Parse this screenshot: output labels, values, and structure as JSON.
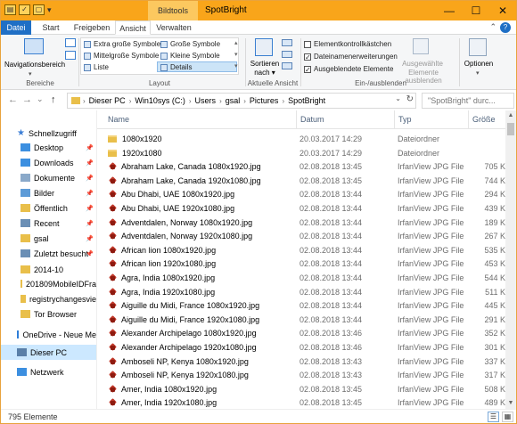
{
  "titlebar": {
    "title": "SpotBright",
    "context_tab": "Bildtools",
    "minimize": "—",
    "maximize": "☐",
    "close": "✕"
  },
  "tabs": [
    {
      "label": "Datei"
    },
    {
      "label": "Start"
    },
    {
      "label": "Freigeben"
    },
    {
      "label": "Ansicht"
    },
    {
      "label": "Verwalten"
    }
  ],
  "ribbon": {
    "bereiche": {
      "nav_pane": "Navigationsbereich",
      "label": "Bereiche"
    },
    "layout": {
      "items": [
        "Extra große Symbole",
        "Große Symbole",
        "Mittelgroße Symbole",
        "Kleine Symbole",
        "Liste",
        "Details"
      ],
      "label": "Layout"
    },
    "aktuelle_ansicht": {
      "sort": "Sortieren",
      "sort_sub": "nach ▾",
      "label": "Aktuelle Ansicht"
    },
    "ein_ausblenden": {
      "checkboxes": [
        {
          "label": "Elementkontrollkästchen",
          "checked": false
        },
        {
          "label": "Dateinamenerweiterungen",
          "checked": true
        },
        {
          "label": "Ausgeblendete Elemente",
          "checked": true
        }
      ],
      "hide_selected": "Ausgewählte",
      "hide_selected2": "Elemente ausblenden",
      "label": "Ein-/ausblenden"
    },
    "options": {
      "label": "Optionen"
    }
  },
  "address": {
    "crumbs": [
      "Dieser PC",
      "Win10sys (C:)",
      "Users",
      "gsal",
      "Pictures",
      "SpotBright"
    ],
    "search_placeholder": "\"SpotBright\" durc...",
    "back": "←",
    "forward": "→",
    "recent": "⌄",
    "up": "↑"
  },
  "navpane": {
    "items": [
      {
        "label": "Schnellzugriff",
        "kind": "star",
        "pinned": false,
        "selected": false,
        "indent": 0
      },
      {
        "label": "Desktop",
        "kind": "folder-blue",
        "pinned": true,
        "selected": false,
        "indent": 1
      },
      {
        "label": "Downloads",
        "kind": "download",
        "pinned": true,
        "selected": false,
        "indent": 1
      },
      {
        "label": "Dokumente",
        "kind": "doc",
        "pinned": true,
        "selected": false,
        "indent": 1
      },
      {
        "label": "Bilder",
        "kind": "pic",
        "pinned": true,
        "selected": false,
        "indent": 1
      },
      {
        "label": "Öffentlich",
        "kind": "folder",
        "pinned": true,
        "selected": false,
        "indent": 1
      },
      {
        "label": "Recent",
        "kind": "recent",
        "pinned": true,
        "selected": false,
        "indent": 1
      },
      {
        "label": "gsal",
        "kind": "folder",
        "pinned": true,
        "selected": false,
        "indent": 1
      },
      {
        "label": "Zuletzt besucht",
        "kind": "recent",
        "pinned": true,
        "selected": false,
        "indent": 1
      },
      {
        "label": "2014-10",
        "kind": "folder",
        "pinned": false,
        "selected": false,
        "indent": 1
      },
      {
        "label": "201809MobileIDFra",
        "kind": "folder",
        "pinned": false,
        "selected": false,
        "indent": 1
      },
      {
        "label": "registrychangesvie",
        "kind": "folder",
        "pinned": false,
        "selected": false,
        "indent": 1
      },
      {
        "label": "Tor Browser",
        "kind": "folder",
        "pinned": false,
        "selected": false,
        "indent": 1
      },
      {
        "label": "OneDrive - Neue Me",
        "kind": "cloud",
        "pinned": false,
        "selected": false,
        "indent": 0
      },
      {
        "label": "Dieser PC",
        "kind": "pc",
        "pinned": false,
        "selected": true,
        "indent": 0
      },
      {
        "label": "Netzwerk",
        "kind": "net",
        "pinned": false,
        "selected": false,
        "indent": 0
      }
    ]
  },
  "filelist": {
    "headers": [
      "Name",
      "Datum",
      "Typ",
      "Größe"
    ],
    "rows": [
      {
        "name": "1080x1920",
        "date": "20.03.2017 14:29",
        "type": "Dateiordner",
        "size": "",
        "kind": "folder"
      },
      {
        "name": "1920x1080",
        "date": "20.03.2017 14:29",
        "type": "Dateiordner",
        "size": "",
        "kind": "folder"
      },
      {
        "name": "Abraham Lake, Canada 1080x1920.jpg",
        "date": "02.08.2018 13:45",
        "type": "IrfanView JPG File",
        "size": "705 K",
        "kind": "jpg"
      },
      {
        "name": "Abraham Lake, Canada 1920x1080.jpg",
        "date": "02.08.2018 13:45",
        "type": "IrfanView JPG File",
        "size": "744 K",
        "kind": "jpg"
      },
      {
        "name": "Abu Dhabi, UAE 1080x1920.jpg",
        "date": "02.08.2018 13:44",
        "type": "IrfanView JPG File",
        "size": "294 K",
        "kind": "jpg"
      },
      {
        "name": "Abu Dhabi, UAE 1920x1080.jpg",
        "date": "02.08.2018 13:44",
        "type": "IrfanView JPG File",
        "size": "439 K",
        "kind": "jpg"
      },
      {
        "name": "Adventdalen, Norway 1080x1920.jpg",
        "date": "02.08.2018 13:44",
        "type": "IrfanView JPG File",
        "size": "189 K",
        "kind": "jpg"
      },
      {
        "name": "Adventdalen, Norway 1920x1080.jpg",
        "date": "02.08.2018 13:44",
        "type": "IrfanView JPG File",
        "size": "267 K",
        "kind": "jpg"
      },
      {
        "name": "African lion 1080x1920.jpg",
        "date": "02.08.2018 13:44",
        "type": "IrfanView JPG File",
        "size": "535 K",
        "kind": "jpg"
      },
      {
        "name": "African lion 1920x1080.jpg",
        "date": "02.08.2018 13:44",
        "type": "IrfanView JPG File",
        "size": "453 K",
        "kind": "jpg"
      },
      {
        "name": "Agra, India 1080x1920.jpg",
        "date": "02.08.2018 13:44",
        "type": "IrfanView JPG File",
        "size": "544 K",
        "kind": "jpg"
      },
      {
        "name": "Agra, India 1920x1080.jpg",
        "date": "02.08.2018 13:44",
        "type": "IrfanView JPG File",
        "size": "511 K",
        "kind": "jpg"
      },
      {
        "name": "Aiguille du Midi, France 1080x1920.jpg",
        "date": "02.08.2018 13:44",
        "type": "IrfanView JPG File",
        "size": "445 K",
        "kind": "jpg"
      },
      {
        "name": "Aiguille du Midi, France 1920x1080.jpg",
        "date": "02.08.2018 13:44",
        "type": "IrfanView JPG File",
        "size": "291 K",
        "kind": "jpg"
      },
      {
        "name": "Alexander Archipelago 1080x1920.jpg",
        "date": "02.08.2018 13:46",
        "type": "IrfanView JPG File",
        "size": "352 K",
        "kind": "jpg"
      },
      {
        "name": "Alexander Archipelago 1920x1080.jpg",
        "date": "02.08.2018 13:46",
        "type": "IrfanView JPG File",
        "size": "301 K",
        "kind": "jpg"
      },
      {
        "name": "Amboseli NP, Kenya 1080x1920.jpg",
        "date": "02.08.2018 13:43",
        "type": "IrfanView JPG File",
        "size": "337 K",
        "kind": "jpg"
      },
      {
        "name": "Amboseli NP, Kenya 1920x1080.jpg",
        "date": "02.08.2018 13:43",
        "type": "IrfanView JPG File",
        "size": "317 K",
        "kind": "jpg"
      },
      {
        "name": "Amer, India 1080x1920.jpg",
        "date": "02.08.2018 13:45",
        "type": "IrfanView JPG File",
        "size": "508 K",
        "kind": "jpg"
      },
      {
        "name": "Amer, India 1920x1080.jpg",
        "date": "02.08.2018 13:45",
        "type": "IrfanView JPG File",
        "size": "489 K",
        "kind": "jpg"
      }
    ]
  },
  "status": {
    "count": "795 Elemente"
  },
  "colors": {
    "titlebar": "#f9a51a",
    "accent": "#1f6fc5",
    "selected": "#cce8ff"
  }
}
